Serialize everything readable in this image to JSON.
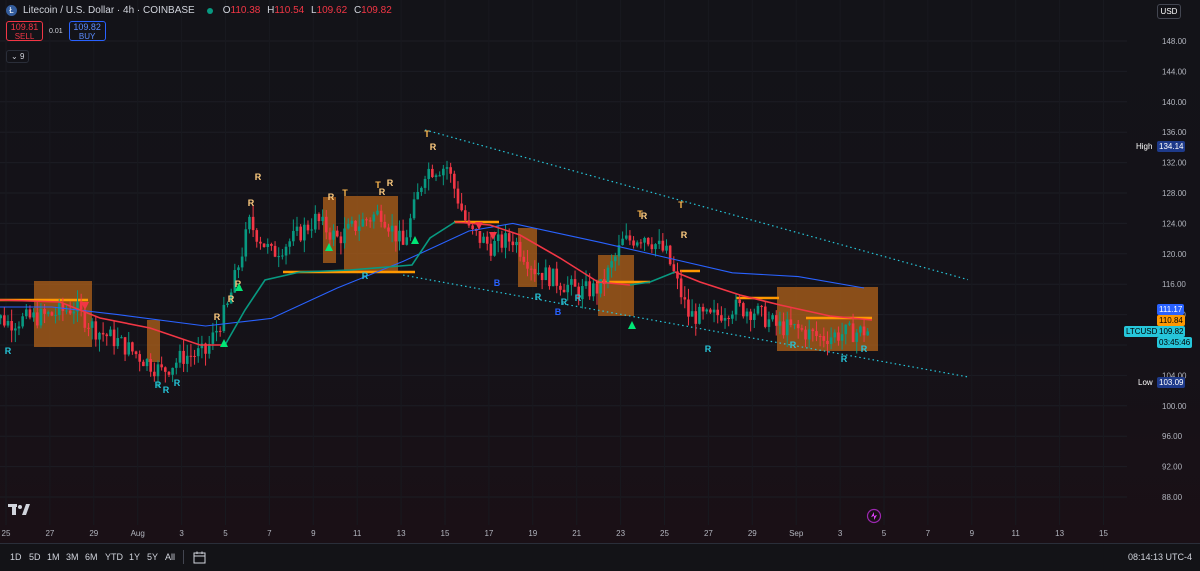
{
  "header": {
    "symbol_title": "Litecoin / U.S. Dollar · 4h · COINBASE",
    "ohlc": [
      {
        "k": "O",
        "v": "110.38"
      },
      {
        "k": "H",
        "v": "110.54"
      },
      {
        "k": "L",
        "v": "109.62"
      },
      {
        "k": "C",
        "v": "109.82"
      }
    ],
    "sell_price": "109.81",
    "sell_label": "SELL",
    "spread": "0.01",
    "buy_price": "109.82",
    "buy_label": "BUY",
    "indicators_toggle": "9",
    "currency": "USD"
  },
  "bottom_bar": {
    "ranges": [
      "1D",
      "5D",
      "1M",
      "3M",
      "6M",
      "YTD",
      "1Y",
      "5Y",
      "All"
    ],
    "time": "08:14:13 UTC-4"
  },
  "colors": {
    "up": "#089981",
    "down": "#f23645",
    "ma": "#2962ff",
    "trend_channel": "#26c6da",
    "fill_box": "#b8651b",
    "level_line": "#ff9800",
    "high_tag": "#1e3a8a",
    "last_tag": "#26c6da"
  },
  "chart_data": {
    "type": "candlestick",
    "symbol": "LTCUSD",
    "interval": "4h",
    "exchange": "COINBASE",
    "y_axis": {
      "ticks": [
        "148.00",
        "144.00",
        "140.00",
        "136.00",
        "132.00",
        "128.00",
        "124.00",
        "120.00",
        "116.00",
        "112.00",
        "108.00",
        "104.00",
        "100.00",
        "96.00",
        "92.00",
        "88.00"
      ],
      "range": [
        86,
        150
      ]
    },
    "x_axis": {
      "ticks": [
        "25",
        "27",
        "29",
        "Aug",
        "3",
        "5",
        "7",
        "9",
        "11",
        "13",
        "15",
        "17",
        "19",
        "21",
        "23",
        "25",
        "27",
        "29",
        "Sep",
        "3",
        "5",
        "7",
        "9",
        "11",
        "13",
        "15"
      ]
    },
    "price_labels": {
      "high_label": "High",
      "high_value": "134.14",
      "low_label": "Low",
      "low_value": "103.09",
      "upper_level": "111.17",
      "mid_level": "110.84",
      "last_symbol": "LTCUSD",
      "last_value": "109.82",
      "countdown": "03:45:46"
    },
    "close_path": [
      {
        "date": "Jul 24",
        "close": 112.5
      },
      {
        "date": "Jul 25",
        "close": 111.0
      },
      {
        "date": "Jul 26",
        "close": 111.5
      },
      {
        "date": "Jul 27",
        "close": 112.0
      },
      {
        "date": "Jul 28",
        "close": 113.0
      },
      {
        "date": "Jul 29",
        "close": 110.0
      },
      {
        "date": "Jul 30",
        "close": 108.5
      },
      {
        "date": "Jul 31",
        "close": 106.5
      },
      {
        "date": "Aug 1",
        "close": 104.5
      },
      {
        "date": "Aug 2",
        "close": 106.5
      },
      {
        "date": "Aug 3",
        "close": 107.0
      },
      {
        "date": "Aug 4",
        "close": 113.0
      },
      {
        "date": "Aug 5",
        "close": 124.0
      },
      {
        "date": "Aug 6",
        "close": 120.0
      },
      {
        "date": "Aug 7",
        "close": 122.0
      },
      {
        "date": "Aug 8",
        "close": 124.5
      },
      {
        "date": "Aug 9",
        "close": 122.0
      },
      {
        "date": "Aug 10",
        "close": 124.0
      },
      {
        "date": "Aug 11",
        "close": 125.5
      },
      {
        "date": "Aug 12",
        "close": 121.0
      },
      {
        "date": "Aug 13",
        "close": 131.0
      },
      {
        "date": "Aug 14",
        "close": 131.5
      },
      {
        "date": "Aug 15",
        "close": 123.0
      },
      {
        "date": "Aug 16",
        "close": 121.0
      },
      {
        "date": "Aug 17",
        "close": 122.0
      },
      {
        "date": "Aug 18",
        "close": 118.0
      },
      {
        "date": "Aug 19",
        "close": 116.5
      },
      {
        "date": "Aug 20",
        "close": 115.0
      },
      {
        "date": "Aug 21",
        "close": 115.5
      },
      {
        "date": "Aug 22",
        "close": 121.5
      },
      {
        "date": "Aug 23",
        "close": 122.5
      },
      {
        "date": "Aug 24",
        "close": 120.0
      },
      {
        "date": "Aug 25",
        "close": 112.0
      },
      {
        "date": "Aug 26",
        "close": 111.5
      },
      {
        "date": "Aug 27",
        "close": 113.0
      },
      {
        "date": "Aug 28",
        "close": 112.5
      },
      {
        "date": "Aug 29",
        "close": 110.5
      },
      {
        "date": "Aug 30",
        "close": 110.0
      },
      {
        "date": "Aug 31",
        "close": 109.0
      },
      {
        "date": "Sep 1",
        "close": 109.5
      },
      {
        "date": "Sep 2",
        "close": 109.82
      }
    ],
    "ma_path": [
      {
        "date": "Jul 24",
        "value": 113.0
      },
      {
        "date": "Jul 27",
        "value": 113.0
      },
      {
        "date": "Jul 30",
        "value": 112.0
      },
      {
        "date": "Aug 3",
        "value": 110.5
      },
      {
        "date": "Aug 6",
        "value": 111.5
      },
      {
        "date": "Aug 9",
        "value": 115.5
      },
      {
        "date": "Aug 12",
        "value": 119.0
      },
      {
        "date": "Aug 15",
        "value": 123.0
      },
      {
        "date": "Aug 17",
        "value": 124.0
      },
      {
        "date": "Aug 21",
        "value": 121.5
      },
      {
        "date": "Aug 24",
        "value": 119.5
      },
      {
        "date": "Aug 27",
        "value": 117.5
      },
      {
        "date": "Aug 30",
        "value": 117.0
      },
      {
        "date": "Sep 2",
        "value": 115.5
      }
    ],
    "trend_channel": {
      "upper": [
        {
          "date": "Aug 13",
          "value": 136.3
        },
        {
          "date": "Sep 4",
          "value": 116.6
        }
      ],
      "lower": [
        {
          "date": "Aug 12",
          "value": 117.2
        },
        {
          "date": "Sep 4",
          "value": 103.8
        }
      ]
    },
    "marker_labels": [
      "T",
      "R",
      "B"
    ]
  }
}
